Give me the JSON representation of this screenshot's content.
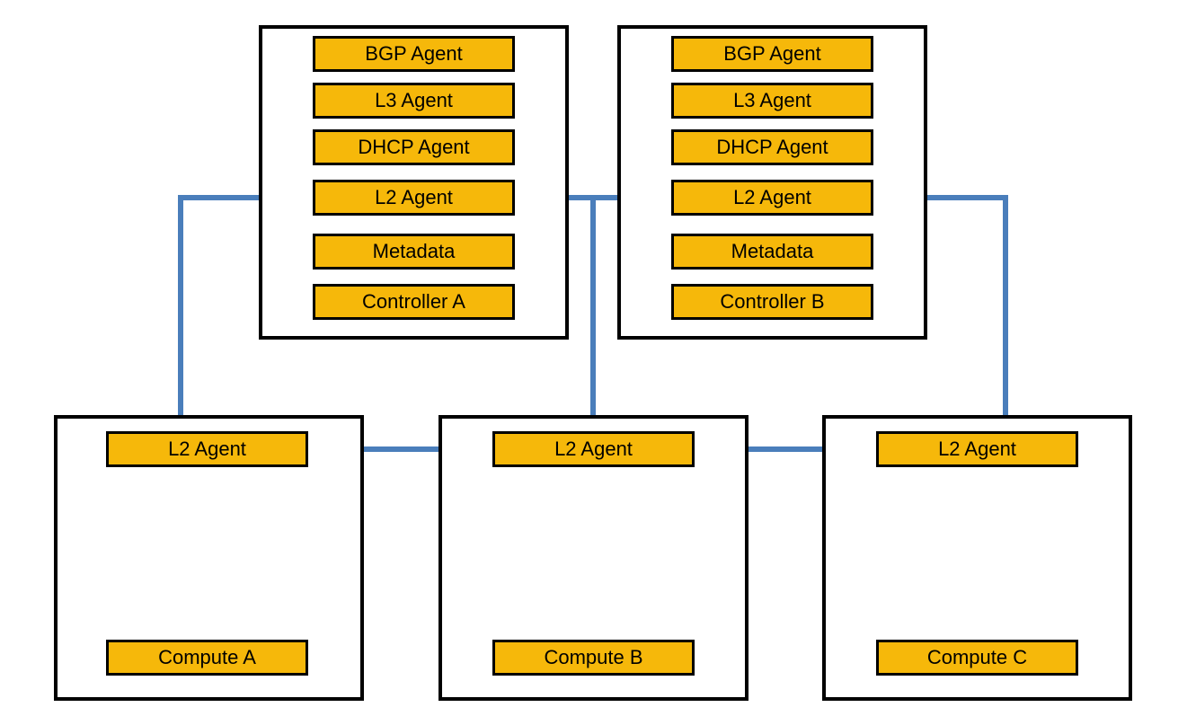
{
  "controllers": [
    {
      "name": "Controller A",
      "agents": [
        "BGP Agent",
        "L3 Agent",
        "DHCP Agent",
        "L2 Agent",
        "Metadata",
        "Controller A"
      ]
    },
    {
      "name": "Controller B",
      "agents": [
        "BGP Agent",
        "L3 Agent",
        "DHCP Agent",
        "L2 Agent",
        "Metadata",
        "Controller B"
      ]
    }
  ],
  "computes": [
    {
      "name": "Compute A",
      "l2": "L2 Agent"
    },
    {
      "name": "Compute B",
      "l2": "L2 Agent"
    },
    {
      "name": "Compute C",
      "l2": "L2 Agent"
    }
  ],
  "colors": {
    "agent_fill": "#f6b80a",
    "connection": "#4a7ebb"
  }
}
